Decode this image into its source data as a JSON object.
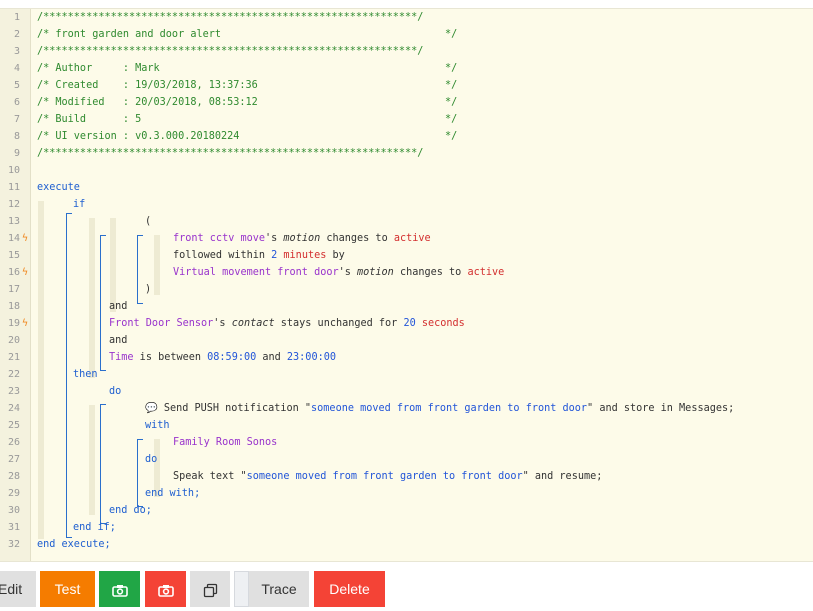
{
  "code": {
    "lines": [
      "1",
      "2",
      "3",
      "4",
      "5",
      "6",
      "7",
      "8",
      "9",
      "10",
      "11",
      "12",
      "13",
      "14",
      "15",
      "16",
      "17",
      "18",
      "19",
      "20",
      "21",
      "22",
      "23",
      "24",
      "25",
      "26",
      "27",
      "28",
      "29",
      "30",
      "31",
      "32"
    ],
    "header_rule": "/*************************************************************/",
    "header_title_left": "/* front garden and door alert",
    "header_end": "*/",
    "author_label": "/* Author     : Mark",
    "created_label": "/* Created    : 19/03/2018, 13:37:36",
    "modified_label": "/* Modified   : 20/03/2018, 08:53:12",
    "build_label": "/* Build      : 5",
    "ui_label": "/* UI version : v0.3.000.20180224",
    "execute": "execute",
    "if": "if",
    "open_paren": "(",
    "close_paren": ")",
    "c1_device": "front cctv move",
    "c1_poss": "'s ",
    "c1_attr": "motion",
    "c1_mid": " changes to ",
    "c1_val": "active",
    "c2_pre": "followed within ",
    "c2_num": "2",
    "c2_unit": " minutes",
    "c2_post": " by",
    "c3_device": "Virtual movement front door",
    "c3_poss": "'s ",
    "c3_attr": "motion",
    "c3_mid": " changes to ",
    "c3_val": "active",
    "and1": "and",
    "c4_device": "Front Door Sensor",
    "c4_poss": "'s ",
    "c4_attr": "contact",
    "c4_mid": " stays unchanged for ",
    "c4_num": "20",
    "c4_unit": " seconds",
    "and2": "and",
    "c5_device": "Time",
    "c5_mid": " is between ",
    "c5_t1": "08:59:00",
    "c5_and": " and ",
    "c5_t2": "23:00:00",
    "then": "then",
    "do": "do",
    "push_pre": " Send PUSH notification \"",
    "push_msg": "someone moved from front garden to front door",
    "push_post": "\" and store in Messages;",
    "with": "with",
    "with_device": "Family Room Sonos",
    "do2": "do",
    "speak_pre": "Speak text \"",
    "speak_msg": "someone moved from front garden to front door",
    "speak_post": "\" and resume;",
    "end_with": "end with;",
    "end_do": "end do;",
    "end_if": "end if;",
    "end_execute": "end execute;"
  },
  "toolbar": {
    "edit": "Edit",
    "test": "Test",
    "trace": "Trace",
    "delete": "Delete"
  },
  "colors": {
    "test": "#f57c00",
    "camera_green": "#21a646",
    "camera_red": "#f44336",
    "delete": "#f44336",
    "neutral": "#e0e0e0"
  },
  "icons": [
    "lightning-bolt-icon",
    "chat-bubble-icon",
    "camera-icon",
    "copy-icon"
  ]
}
